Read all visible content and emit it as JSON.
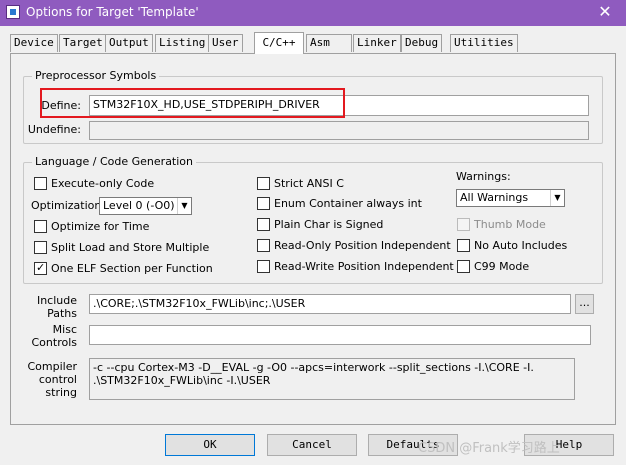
{
  "window": {
    "title": "Options for Target 'Template'",
    "close_glyph": "✕"
  },
  "tabs": [
    {
      "label": "Device"
    },
    {
      "label": "Target"
    },
    {
      "label": "Output"
    },
    {
      "label": "Listing"
    },
    {
      "label": "User"
    },
    {
      "label": "C/C++"
    },
    {
      "label": "Asm"
    },
    {
      "label": "Linker"
    },
    {
      "label": "Debug"
    },
    {
      "label": "Utilities"
    }
  ],
  "active_tab": "C/C++",
  "preprocessor": {
    "group_title": "Preprocessor Symbols",
    "define_label": "Define:",
    "define_value": "STM32F10X_HD,USE_STDPERIPH_DRIVER",
    "undefine_label": "Undefine:",
    "undefine_value": ""
  },
  "language": {
    "group_title": "Language / Code Generation",
    "execute_only": {
      "label": "Execute-only Code",
      "checked": false
    },
    "optimization_label": "Optimization:",
    "optimization_value": "Level 0 (-O0)",
    "optimize_time": {
      "label": "Optimize for Time",
      "checked": false
    },
    "split_load": {
      "label": "Split Load and Store Multiple",
      "checked": false
    },
    "one_elf": {
      "label": "One ELF Section per Function",
      "checked": true
    },
    "strict_ansi": {
      "label": "Strict ANSI C",
      "checked": false
    },
    "enum_container": {
      "label": "Enum Container always int",
      "checked": false
    },
    "plain_char": {
      "label": "Plain Char is Signed",
      "checked": false
    },
    "ro_pos": {
      "label": "Read-Only Position Independent",
      "checked": false
    },
    "rw_pos": {
      "label": "Read-Write Position Independent",
      "checked": false
    },
    "warnings_label": "Warnings:",
    "warnings_value": "All Warnings",
    "thumb_mode": {
      "label": "Thumb Mode",
      "checked": false,
      "disabled": true
    },
    "no_auto_includes": {
      "label": "No Auto Includes",
      "checked": false
    },
    "c99_mode": {
      "label": "C99 Mode",
      "checked": false
    }
  },
  "paths": {
    "include_label_1": "Include",
    "include_label_2": "Paths",
    "include_value": ".\\CORE;.\\STM32F10x_FWLib\\inc;.\\USER",
    "browse_label": "...",
    "misc_label_1": "Misc",
    "misc_label_2": "Controls",
    "misc_value": "",
    "compiler_label_1": "Compiler",
    "compiler_label_2": "control",
    "compiler_label_3": "string",
    "compiler_value": "-c --cpu Cortex-M3 -D__EVAL -g -O0 --apcs=interwork --split_sections -I.\\CORE -I.\n.\\STM32F10x_FWLib\\inc -I.\\USER"
  },
  "buttons": {
    "ok": "OK",
    "cancel": "Cancel",
    "defaults": "Defaults",
    "help": "Help"
  },
  "watermark": "CSDN @Frank学习路上",
  "colors": {
    "titlebar": "#8f5bbf",
    "highlight": "#e3191f"
  }
}
